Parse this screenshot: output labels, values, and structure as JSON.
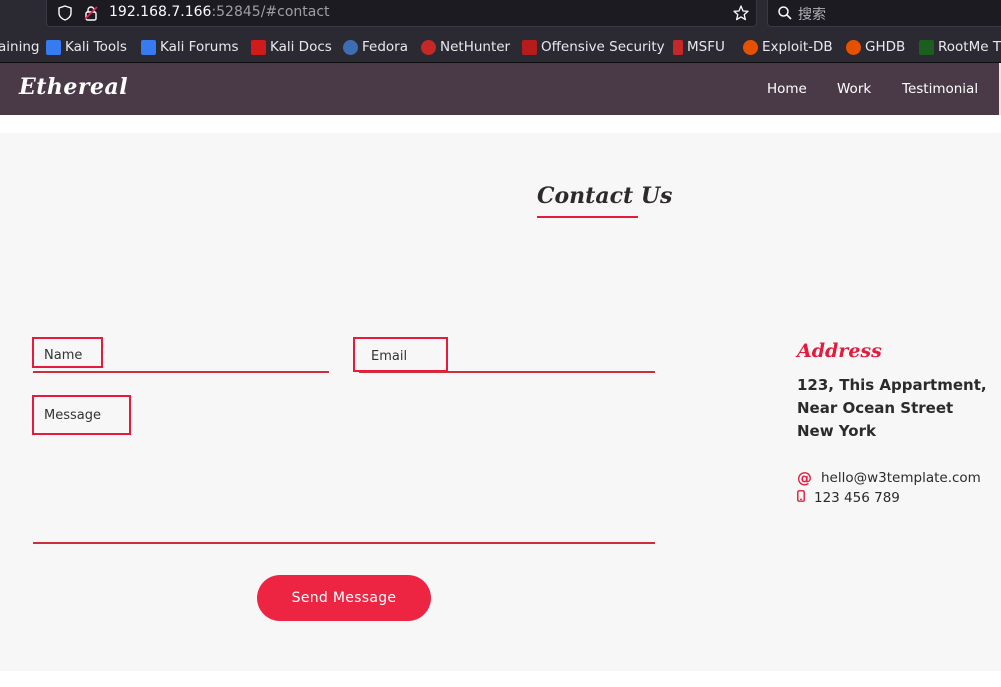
{
  "browser": {
    "url_host": "192.168.7.166",
    "url_rest": ":52845/#contact",
    "search_placeholder": "搜索",
    "bookmarks": [
      {
        "label": "aining",
        "color": ""
      },
      {
        "label": "Kali Tools",
        "color": "#367bf0"
      },
      {
        "label": "Kali Forums",
        "color": "#367bf0"
      },
      {
        "label": "Kali Docs",
        "color": "#d11a1a"
      },
      {
        "label": "Fedora",
        "color": "#3c6eb4"
      },
      {
        "label": "NetHunter",
        "color": "#c62828"
      },
      {
        "label": "Offensive Security",
        "color": "#b71c1c"
      },
      {
        "label": "MSFU",
        "color": "#c62828"
      },
      {
        "label": "Exploit-DB",
        "color": "#e65100"
      },
      {
        "label": "GHDB",
        "color": "#e65100"
      },
      {
        "label": "RootMe T",
        "color": "#1b5e20"
      }
    ]
  },
  "site": {
    "brand": "Ethereal",
    "nav": [
      "Home",
      "Work",
      "Testimonial"
    ]
  },
  "contact": {
    "title": "Contact Us",
    "name_label": "Name",
    "email_label": "Email",
    "message_label": "Message",
    "send_label": "Send Message"
  },
  "address": {
    "title": "Address",
    "line1": "123, This Appartment,",
    "line2": "Near Ocean Street",
    "line3": "New York",
    "email": "hello@w3template.com",
    "phone": "123 456 789"
  },
  "colors": {
    "accent": "#e51a3d",
    "navbar": "#4a3a47",
    "button": "#ee2443"
  }
}
